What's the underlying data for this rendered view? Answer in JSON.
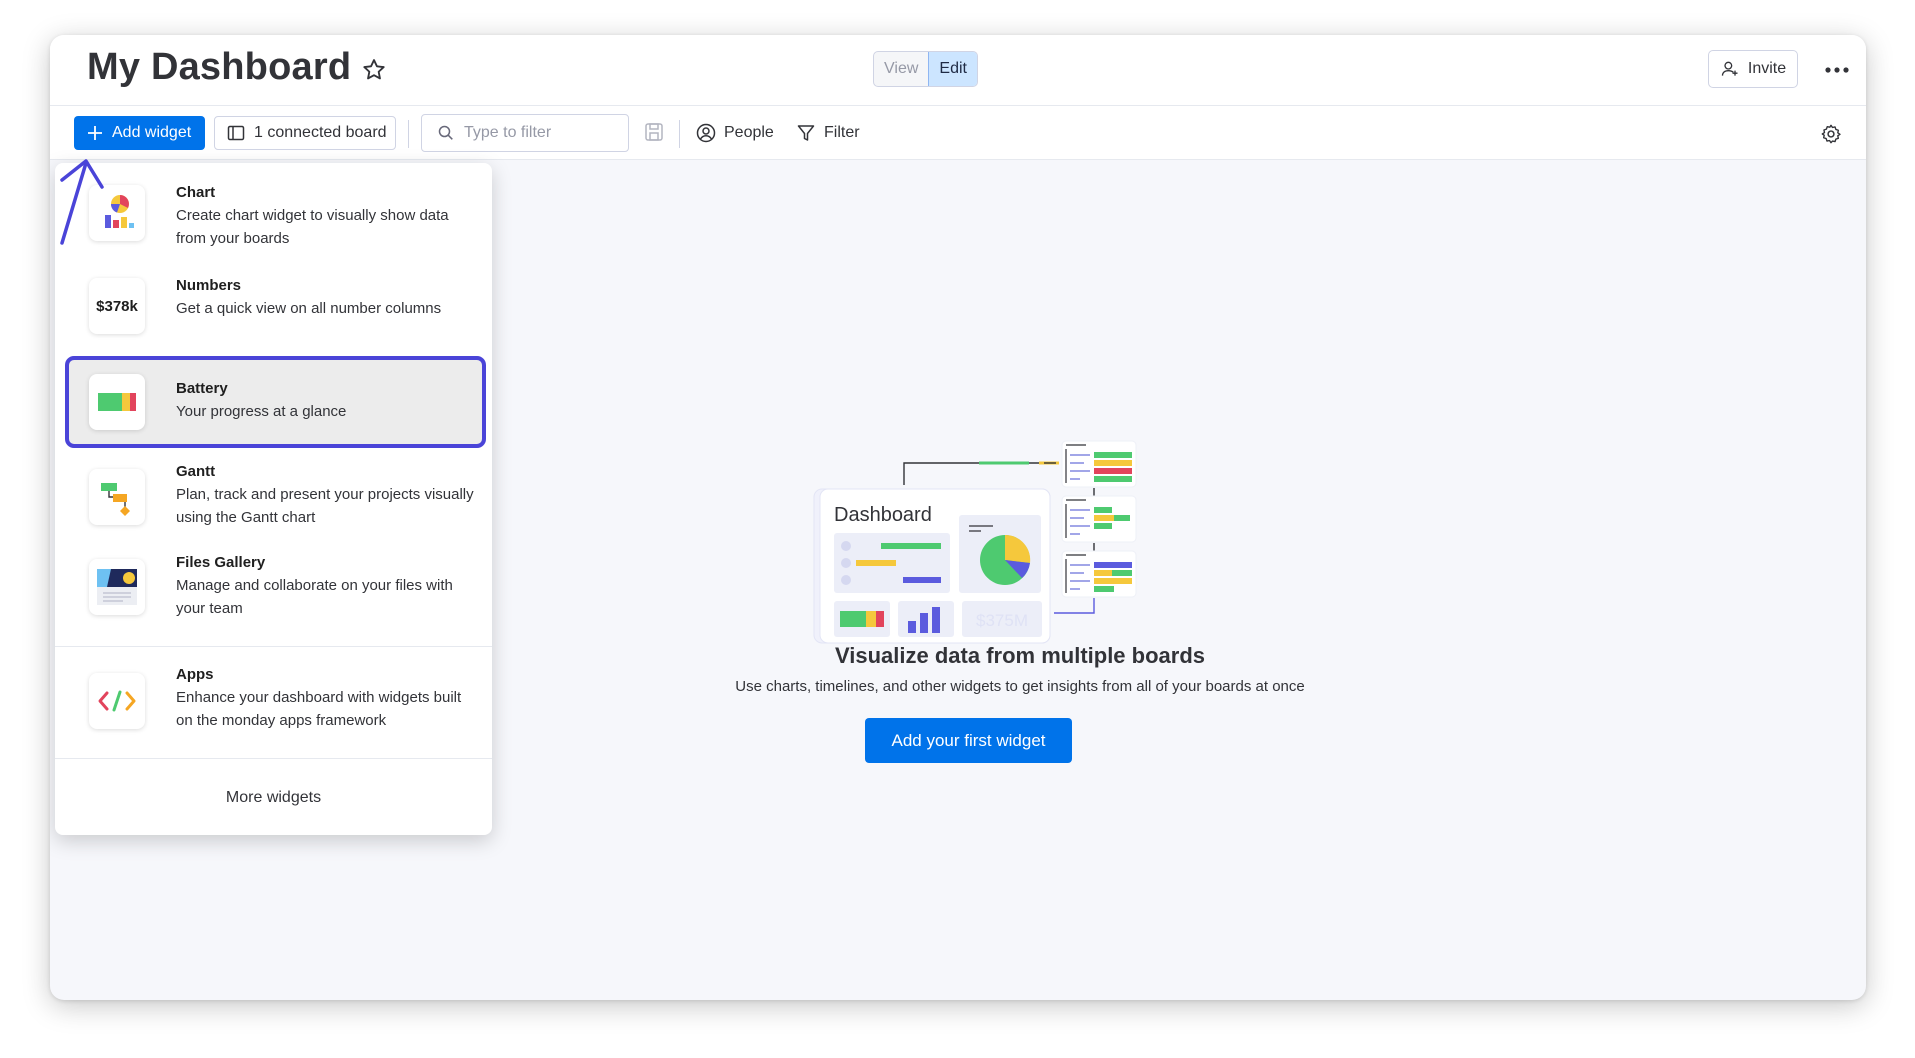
{
  "header": {
    "title": "My Dashboard",
    "view_label": "View",
    "edit_label": "Edit",
    "invite_label": "Invite"
  },
  "toolbar": {
    "add_widget_label": "Add widget",
    "connected_board_label": "1 connected board",
    "search_placeholder": "Type to filter",
    "people_label": "People",
    "filter_label": "Filter"
  },
  "widget_menu": {
    "items": [
      {
        "title": "Chart",
        "description": "Create chart widget to visually show data from your boards",
        "icon": "chart-icon"
      },
      {
        "title": "Numbers",
        "description": "Get a quick view on all number columns",
        "icon": "numbers-icon",
        "glyph": "$378k"
      },
      {
        "title": "Battery",
        "description": "Your progress at a glance",
        "icon": "battery-icon",
        "highlighted": true
      },
      {
        "title": "Gantt",
        "description": "Plan, track and present your projects visually using the Gantt chart",
        "icon": "gantt-icon"
      },
      {
        "title": "Files Gallery",
        "description": "Manage and collaborate on your files with your team",
        "icon": "files-gallery-icon"
      },
      {
        "title": "Apps",
        "description": "Enhance your dashboard with widgets built on the monday apps framework",
        "icon": "apps-icon"
      }
    ],
    "more_label": "More widgets"
  },
  "empty_state": {
    "illustration_title": "Dashboard",
    "illustration_amount": "$375M",
    "title": "Visualize data from multiple boards",
    "subtitle": "Use charts, timelines, and other widgets to get insights from all of your boards at once",
    "cta_label": "Add your first widget"
  },
  "colors": {
    "primary": "#0073ea",
    "highlight_border": "#4a44d8",
    "edit_active_bg": "#cce5ff",
    "green": "#4eca70",
    "yellow": "#f5c83c",
    "purple": "#5b5bde",
    "red": "#e2445c"
  }
}
